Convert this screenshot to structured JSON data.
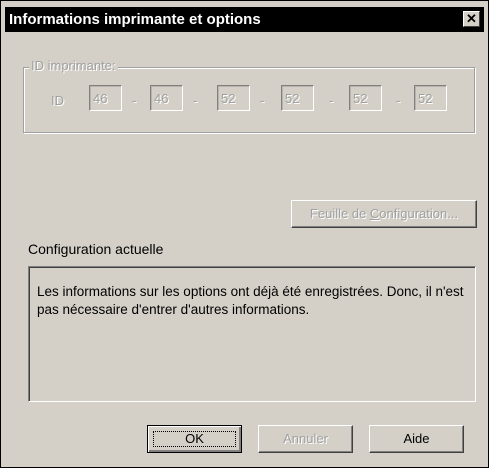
{
  "window": {
    "title": "Informations imprimante et options",
    "close_glyph": "✕"
  },
  "printer_id": {
    "group_label": "ID imprimante:",
    "id_label": "ID",
    "fields": [
      "46",
      "46",
      "52",
      "52",
      "52",
      "52"
    ],
    "separator": "-"
  },
  "config_sheet_button": {
    "label_prefix": "Feuille de ",
    "label_accel": "C",
    "label_suffix": "onfiguration..."
  },
  "current_config": {
    "label": "Configuration actuelle",
    "text": "Les informations sur les options ont déjà été enregistrées. Donc, il n'est pas nécessaire d'entrer d'autres informations."
  },
  "buttons": {
    "ok": "OK",
    "cancel": "Annuler",
    "help": "Aide"
  }
}
